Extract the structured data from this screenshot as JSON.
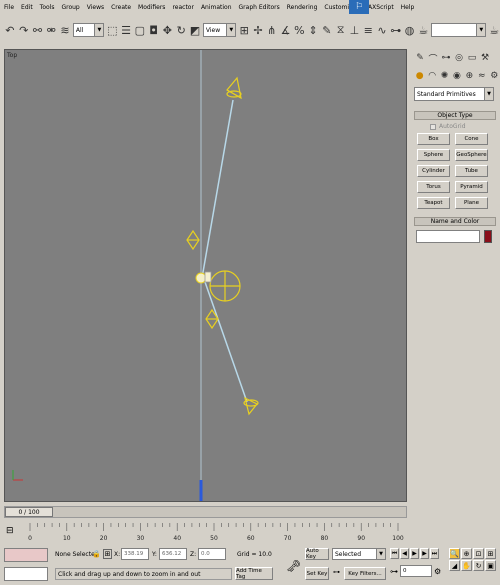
{
  "menu": [
    "File",
    "Edit",
    "Tools",
    "Group",
    "Views",
    "Create",
    "Modifiers",
    "reactor",
    "Animation",
    "Graph Editors",
    "Rendering",
    "Customize",
    "MAXScript",
    "Help"
  ],
  "toolbar": {
    "selection_filter": "All",
    "ref_coord": "View",
    "named_sel": ""
  },
  "viewport": {
    "label": "Top"
  },
  "panel": {
    "category": "Standard Primitives",
    "object_type_header": "Object Type",
    "autogrid": "AutoGrid",
    "buttons": [
      "Box",
      "Cone",
      "Sphere",
      "GeoSphere",
      "Cylinder",
      "Tube",
      "Torus",
      "Pyramid",
      "Teapot",
      "Plane"
    ],
    "name_color_header": "Name and Color",
    "name_value": "",
    "color": "#8a0f1a"
  },
  "timeline": {
    "slider_text": "0 / 100",
    "ticks": [
      "0",
      "10",
      "20",
      "30",
      "40",
      "50",
      "60",
      "70",
      "80",
      "90",
      "100"
    ]
  },
  "status": {
    "selection": "None Selected",
    "x_label": "X:",
    "x_value": "338.19",
    "y_label": "Y:",
    "y_value": "636.12",
    "z_label": "Z:",
    "z_value": "0.0",
    "grid": "Grid = 10.0",
    "prompt": "Click and drag up and down to zoom in and out",
    "add_time_tag": "Add Time Tag",
    "auto_key": "Auto Key",
    "set_key": "Set Key",
    "key_mode": "Selected",
    "key_filters": "Key Filters...",
    "frame": "0"
  }
}
